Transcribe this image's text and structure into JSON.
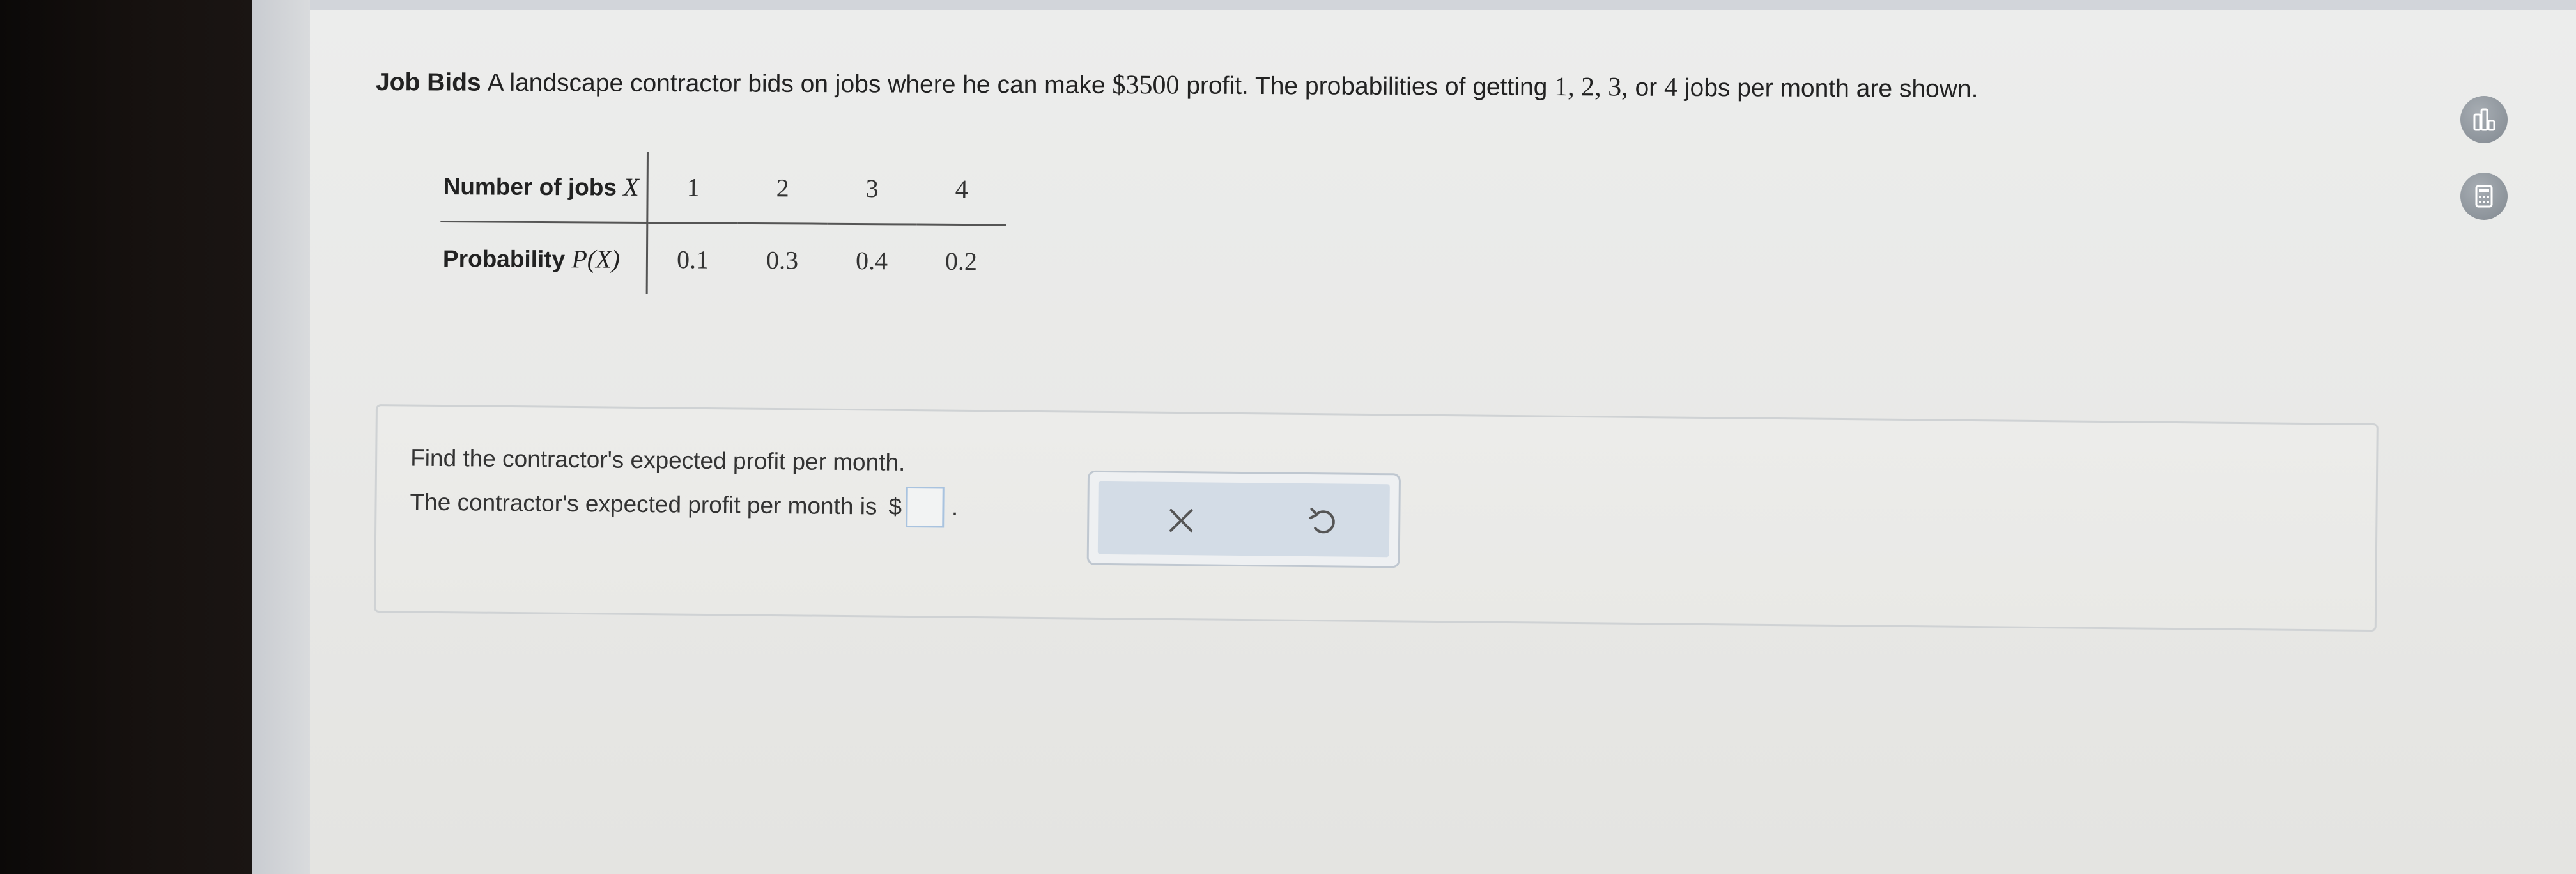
{
  "problem": {
    "title": "Job Bids",
    "text_before": "A landscape contractor bids on jobs where he can make ",
    "profit": "$3500",
    "text_middle": " profit. The probabilities of getting ",
    "job_counts": "1, 2, 3,",
    "text_or": " or ",
    "last_count": "4",
    "text_after": " jobs per month are shown."
  },
  "table": {
    "row1": {
      "label": "Number of jobs",
      "var": "X",
      "values": [
        "1",
        "2",
        "3",
        "4"
      ]
    },
    "row2": {
      "label": "Probability",
      "var": "P(X)",
      "values": [
        "0.1",
        "0.3",
        "0.4",
        "0.2"
      ]
    }
  },
  "question": {
    "prompt": "Find the contractor's expected profit per month.",
    "answer_prefix": "The contractor's expected profit per month is",
    "currency": "$",
    "answer_value": "",
    "suffix": "."
  },
  "icons": {
    "clear": "close-x-icon",
    "undo": "undo-icon",
    "stats": "statistics-bars-icon",
    "calculator": "calculator-icon"
  },
  "colors": {
    "action_fill": "#d3dce6",
    "input_border": "#a9c3df",
    "tool_button": "#8d949b"
  }
}
